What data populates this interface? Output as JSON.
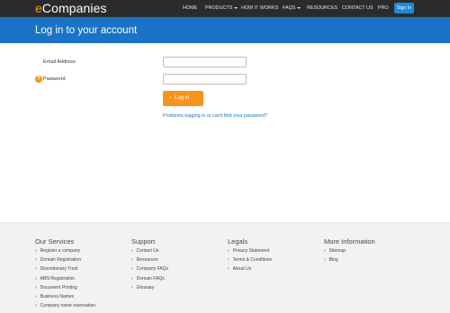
{
  "brand": {
    "prefix": "e",
    "name": "Companies"
  },
  "nav": {
    "items": [
      {
        "label": "HOME"
      },
      {
        "label": "PRODUCTS"
      },
      {
        "label": "HOW IT WORKS"
      },
      {
        "label": "FAQS"
      },
      {
        "label": "RESOURCES"
      },
      {
        "label": "CONTACT US"
      },
      {
        "label": "PRO"
      }
    ],
    "signin_label": "Sign In"
  },
  "page": {
    "title": "Log in to your account"
  },
  "form": {
    "email_label": "Email Address",
    "email_value": "",
    "password_label": "Password",
    "password_value": "",
    "help_icon": "?",
    "login_label": "Log in",
    "problems_link": "Problems logging in or can't find your password?"
  },
  "footer": {
    "services": {
      "heading": "Our Services",
      "links": [
        "Register a company",
        "Domain Registration",
        "Discretionary Trust",
        "ABN Registration",
        "Document Printing",
        "Business Names",
        "Company name reservation"
      ]
    },
    "support": {
      "heading": "Support",
      "links": [
        "Contact Us",
        "Resources",
        "Company FAQs",
        "Domain FAQs",
        "Glossary"
      ]
    },
    "legals": {
      "heading": "Legals",
      "links": [
        "Privacy Statement",
        "Terms & Conditions",
        "About Us"
      ]
    },
    "more": {
      "heading": "More Information",
      "links": [
        "Sitemap",
        "Blog"
      ]
    }
  },
  "colors": {
    "navbar": "#2b2b2b",
    "banner": "#1a73c7",
    "accent": "#f7941d",
    "signin": "#1e88d8"
  }
}
